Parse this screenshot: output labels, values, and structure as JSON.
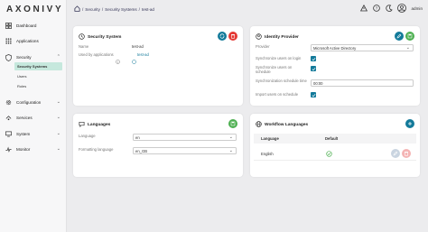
{
  "brand": {
    "logo": "AXONIVY"
  },
  "sidebar": {
    "items": [
      {
        "label": "Dashboard"
      },
      {
        "label": "Applications"
      },
      {
        "label": "Security"
      },
      {
        "label": "Configuration"
      },
      {
        "label": "Services"
      },
      {
        "label": "System"
      },
      {
        "label": "Monitor"
      }
    ],
    "security_sub": [
      {
        "label": "Security Systems"
      },
      {
        "label": "Users"
      },
      {
        "label": "Roles"
      }
    ]
  },
  "breadcrumb": {
    "sep": "/",
    "items": [
      "Security",
      "Security Systems",
      "test-ad"
    ]
  },
  "user": {
    "name": "admin"
  },
  "security_system": {
    "title": "Security System",
    "name_label": "Name",
    "name_value": "test-ad",
    "used_by_label": "Used by applications",
    "used_by_value": "test-ad"
  },
  "identity_provider": {
    "title": "Identity Provider",
    "provider_label": "Provider",
    "provider_value": "Microsoft Active Directory",
    "sync_login_label": "Synchronize users on login",
    "sync_schedule_label": "Synchronize users on schedule",
    "schedule_label": "Synchronization schedule time",
    "schedule_value": "00:00",
    "import_label": "Import users on schedule"
  },
  "languages": {
    "title": "Languages",
    "language_label": "Language",
    "language_value": "en",
    "formatting_label": "Formatting language",
    "formatting_value": "en_GB"
  },
  "workflow_languages": {
    "title": "Workflow Languages",
    "col_language": "Language",
    "col_default": "Default",
    "rows": [
      {
        "language": "English"
      }
    ]
  },
  "colors": {
    "accent": "#4caf50",
    "primary": "#137a9a",
    "danger": "#e53935"
  }
}
